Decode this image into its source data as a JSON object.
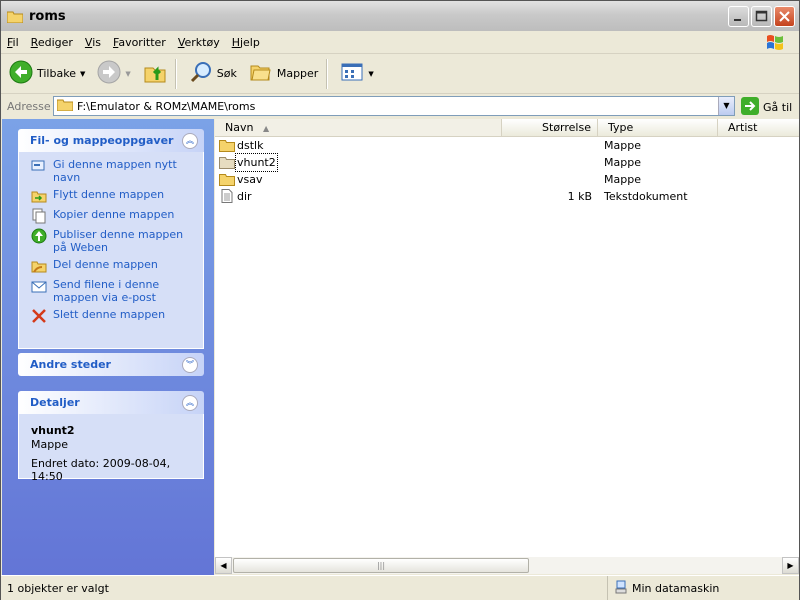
{
  "window": {
    "title": "roms"
  },
  "menu": [
    {
      "label": "Fil",
      "key": "F",
      "rest": "il"
    },
    {
      "label": "Rediger",
      "key": "R",
      "rest": "ediger"
    },
    {
      "label": "Vis",
      "key": "V",
      "rest": "is"
    },
    {
      "label": "Favoritter",
      "key": "F",
      "rest": "avoritter"
    },
    {
      "label": "Verktøy",
      "key": "V",
      "rest": "erktøy"
    },
    {
      "label": "Hjelp",
      "key": "H",
      "rest": "jelp"
    }
  ],
  "toolbar": {
    "back_label": "Tilbake",
    "search_label": "Søk",
    "folders_label": "Mapper"
  },
  "address": {
    "label": "Adresse",
    "path": "F:\\Emulator & ROMz\\MAME\\roms",
    "go_label": "Gå til"
  },
  "tasks_panel": {
    "title": "Fil- og mappeoppgaver",
    "items": [
      {
        "icon": "rename-icon",
        "label": "Gi denne mappen nytt navn"
      },
      {
        "icon": "move-icon",
        "label": "Flytt denne mappen"
      },
      {
        "icon": "copy-icon",
        "label": "Kopier denne mappen"
      },
      {
        "icon": "publish-icon",
        "label": "Publiser denne mappen på Weben"
      },
      {
        "icon": "share-icon",
        "label": "Del denne mappen"
      },
      {
        "icon": "email-icon",
        "label": "Send filene i denne mappen via e-post"
      },
      {
        "icon": "delete-icon",
        "label": "Slett denne mappen"
      }
    ]
  },
  "other_places": {
    "title": "Andre steder"
  },
  "details": {
    "title": "Detaljer",
    "name": "vhunt2",
    "type": "Mappe",
    "modified": "Endret dato: 2009-08-04, 14:50"
  },
  "columns": {
    "name": "Navn",
    "size": "Størrelse",
    "type": "Type",
    "artist": "Artist"
  },
  "files": [
    {
      "name": "dstlk",
      "size": "",
      "type": "Mappe",
      "icon": "folder-icon",
      "selected": false
    },
    {
      "name": "vhunt2",
      "size": "",
      "type": "Mappe",
      "icon": "folder-icon",
      "selected": true
    },
    {
      "name": "vsav",
      "size": "",
      "type": "Mappe",
      "icon": "folder-icon",
      "selected": false
    },
    {
      "name": "dir",
      "size": "1 kB",
      "type": "Tekstdokument",
      "icon": "text-file-icon",
      "selected": false
    }
  ],
  "status": {
    "left": "1 objekter er valgt",
    "right": "Min datamaskin"
  }
}
